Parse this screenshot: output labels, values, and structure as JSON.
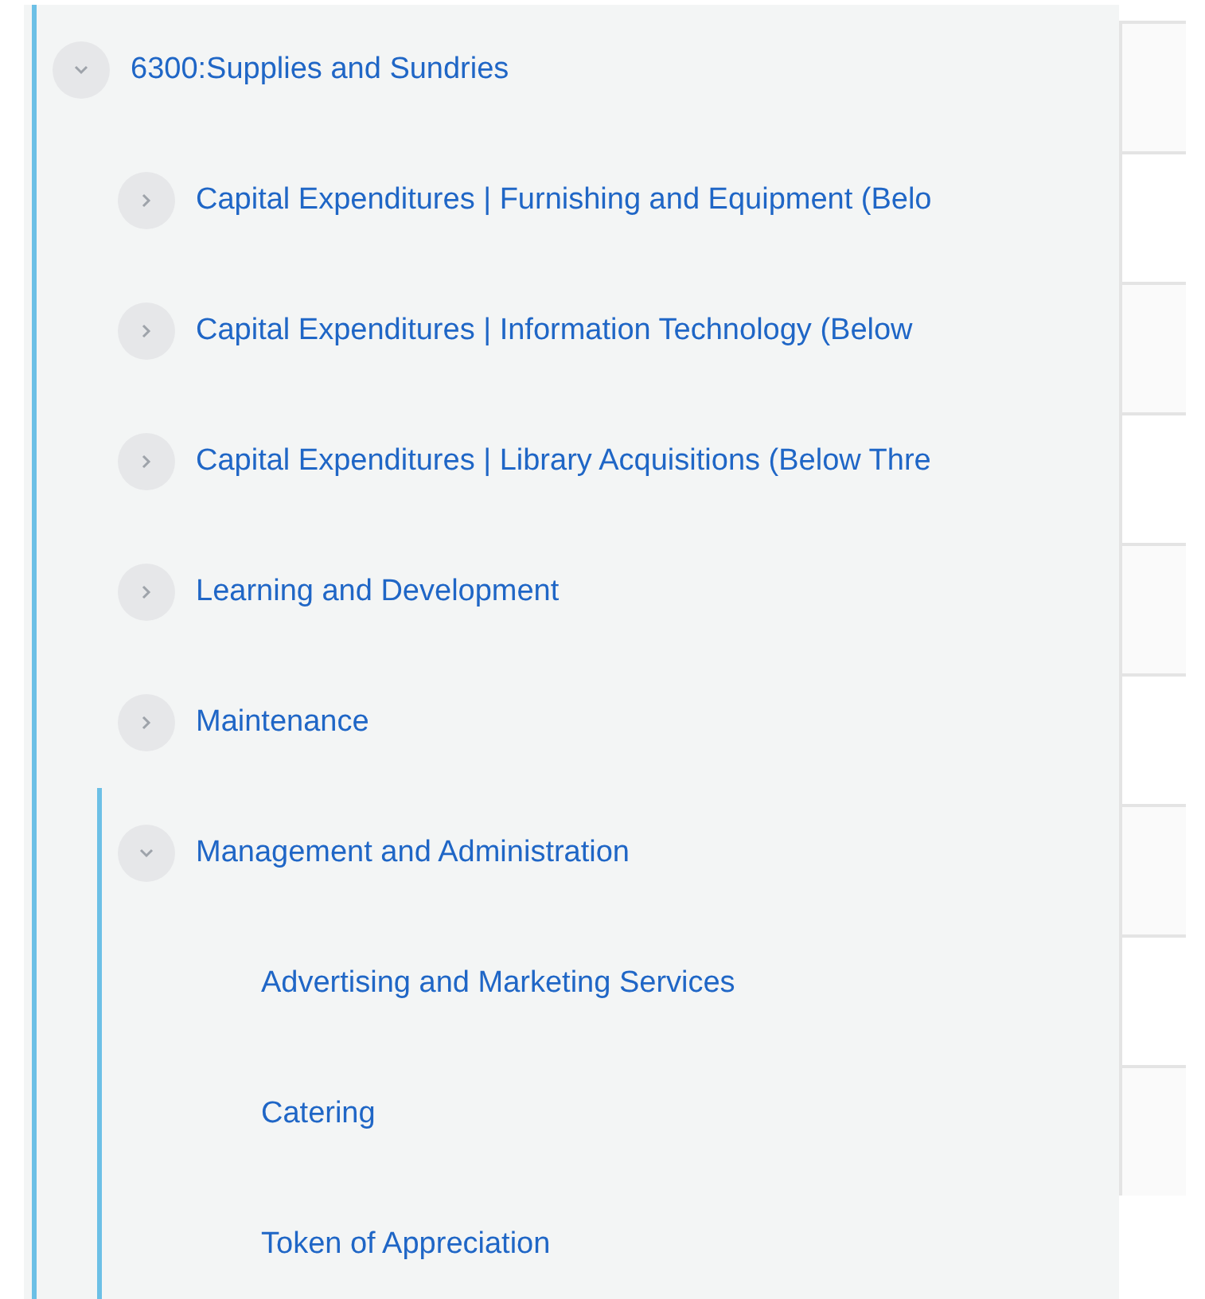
{
  "tree": [
    {
      "label": "6300:Supplies and Sundries",
      "expanded": true,
      "children": [
        {
          "label": "Capital Expenditures | Furnishing and Equipment (Belo",
          "expanded": false
        },
        {
          "label": "Capital Expenditures | Information Technology (Below",
          "expanded": false
        },
        {
          "label": "Capital Expenditures | Library Acquisitions (Below Thre",
          "expanded": false
        },
        {
          "label": "Learning and Development",
          "expanded": false
        },
        {
          "label": "Maintenance",
          "expanded": false
        },
        {
          "label": "Management and Administration",
          "expanded": true,
          "children": [
            {
              "label": "Advertising and Marketing Services"
            },
            {
              "label": "Catering"
            },
            {
              "label": "Token of Appreciation"
            }
          ]
        }
      ]
    }
  ]
}
